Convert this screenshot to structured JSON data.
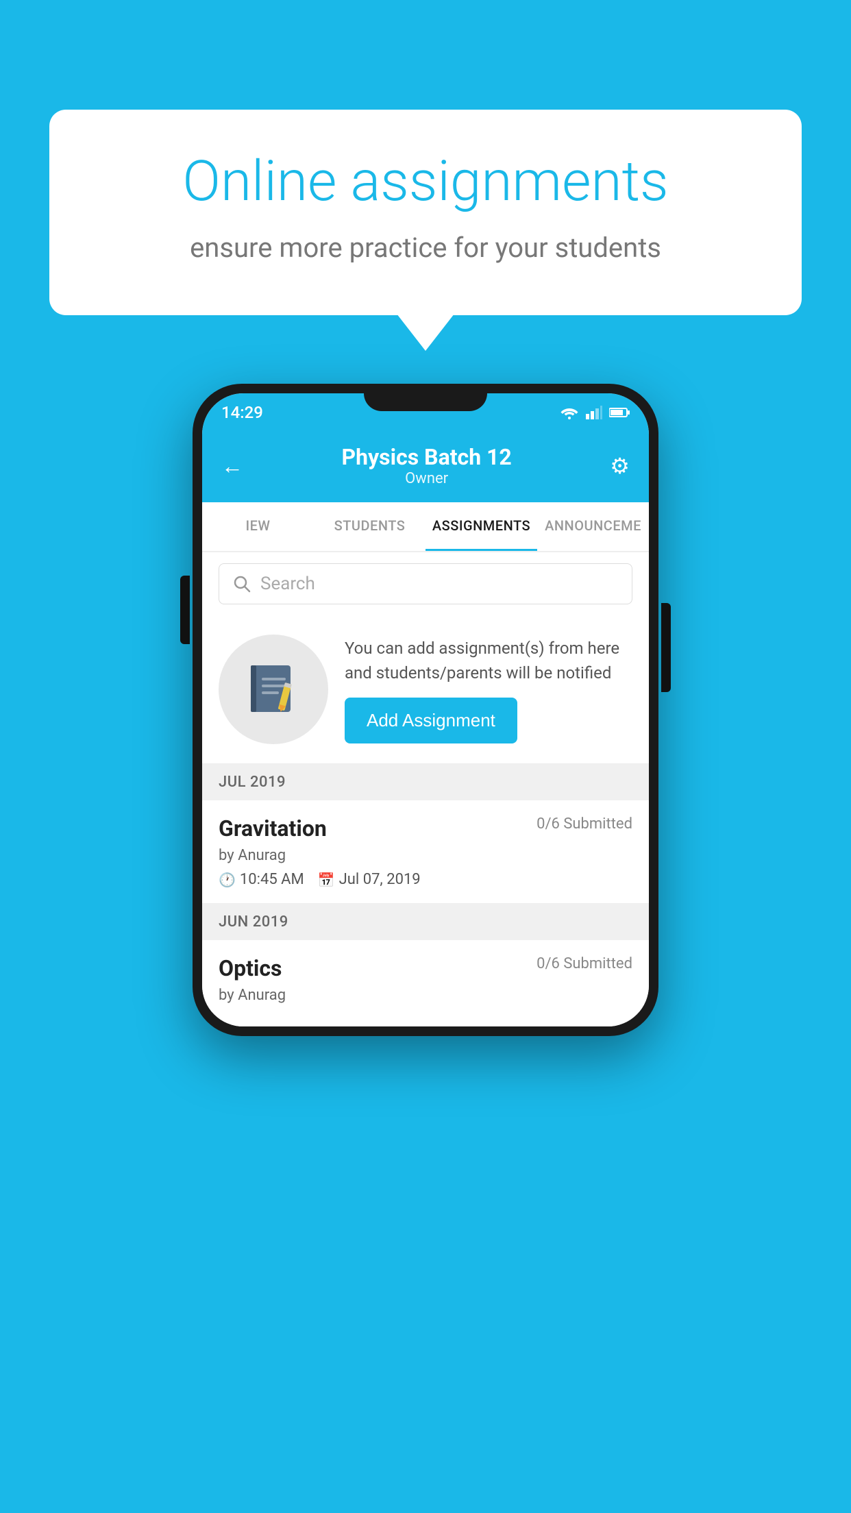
{
  "background": {
    "color": "#1ab8e8"
  },
  "speech_bubble": {
    "title": "Online assignments",
    "subtitle": "ensure more practice for your students"
  },
  "phone": {
    "status_bar": {
      "time": "14:29"
    },
    "header": {
      "title": "Physics Batch 12",
      "subtitle": "Owner",
      "back_label": "←",
      "settings_label": "⚙"
    },
    "tabs": [
      {
        "label": "IEW",
        "active": false
      },
      {
        "label": "STUDENTS",
        "active": false
      },
      {
        "label": "ASSIGNMENTS",
        "active": true
      },
      {
        "label": "ANNOUNCEME",
        "active": false
      }
    ],
    "search": {
      "placeholder": "Search"
    },
    "promo": {
      "text": "You can add assignment(s) from here and students/parents will be notified",
      "button_label": "Add Assignment"
    },
    "sections": [
      {
        "label": "JUL 2019",
        "assignments": [
          {
            "name": "Gravitation",
            "submitted": "0/6 Submitted",
            "by": "by Anurag",
            "time": "10:45 AM",
            "date": "Jul 07, 2019"
          }
        ]
      },
      {
        "label": "JUN 2019",
        "assignments": [
          {
            "name": "Optics",
            "submitted": "0/6 Submitted",
            "by": "by Anurag",
            "time": "",
            "date": ""
          }
        ]
      }
    ]
  }
}
